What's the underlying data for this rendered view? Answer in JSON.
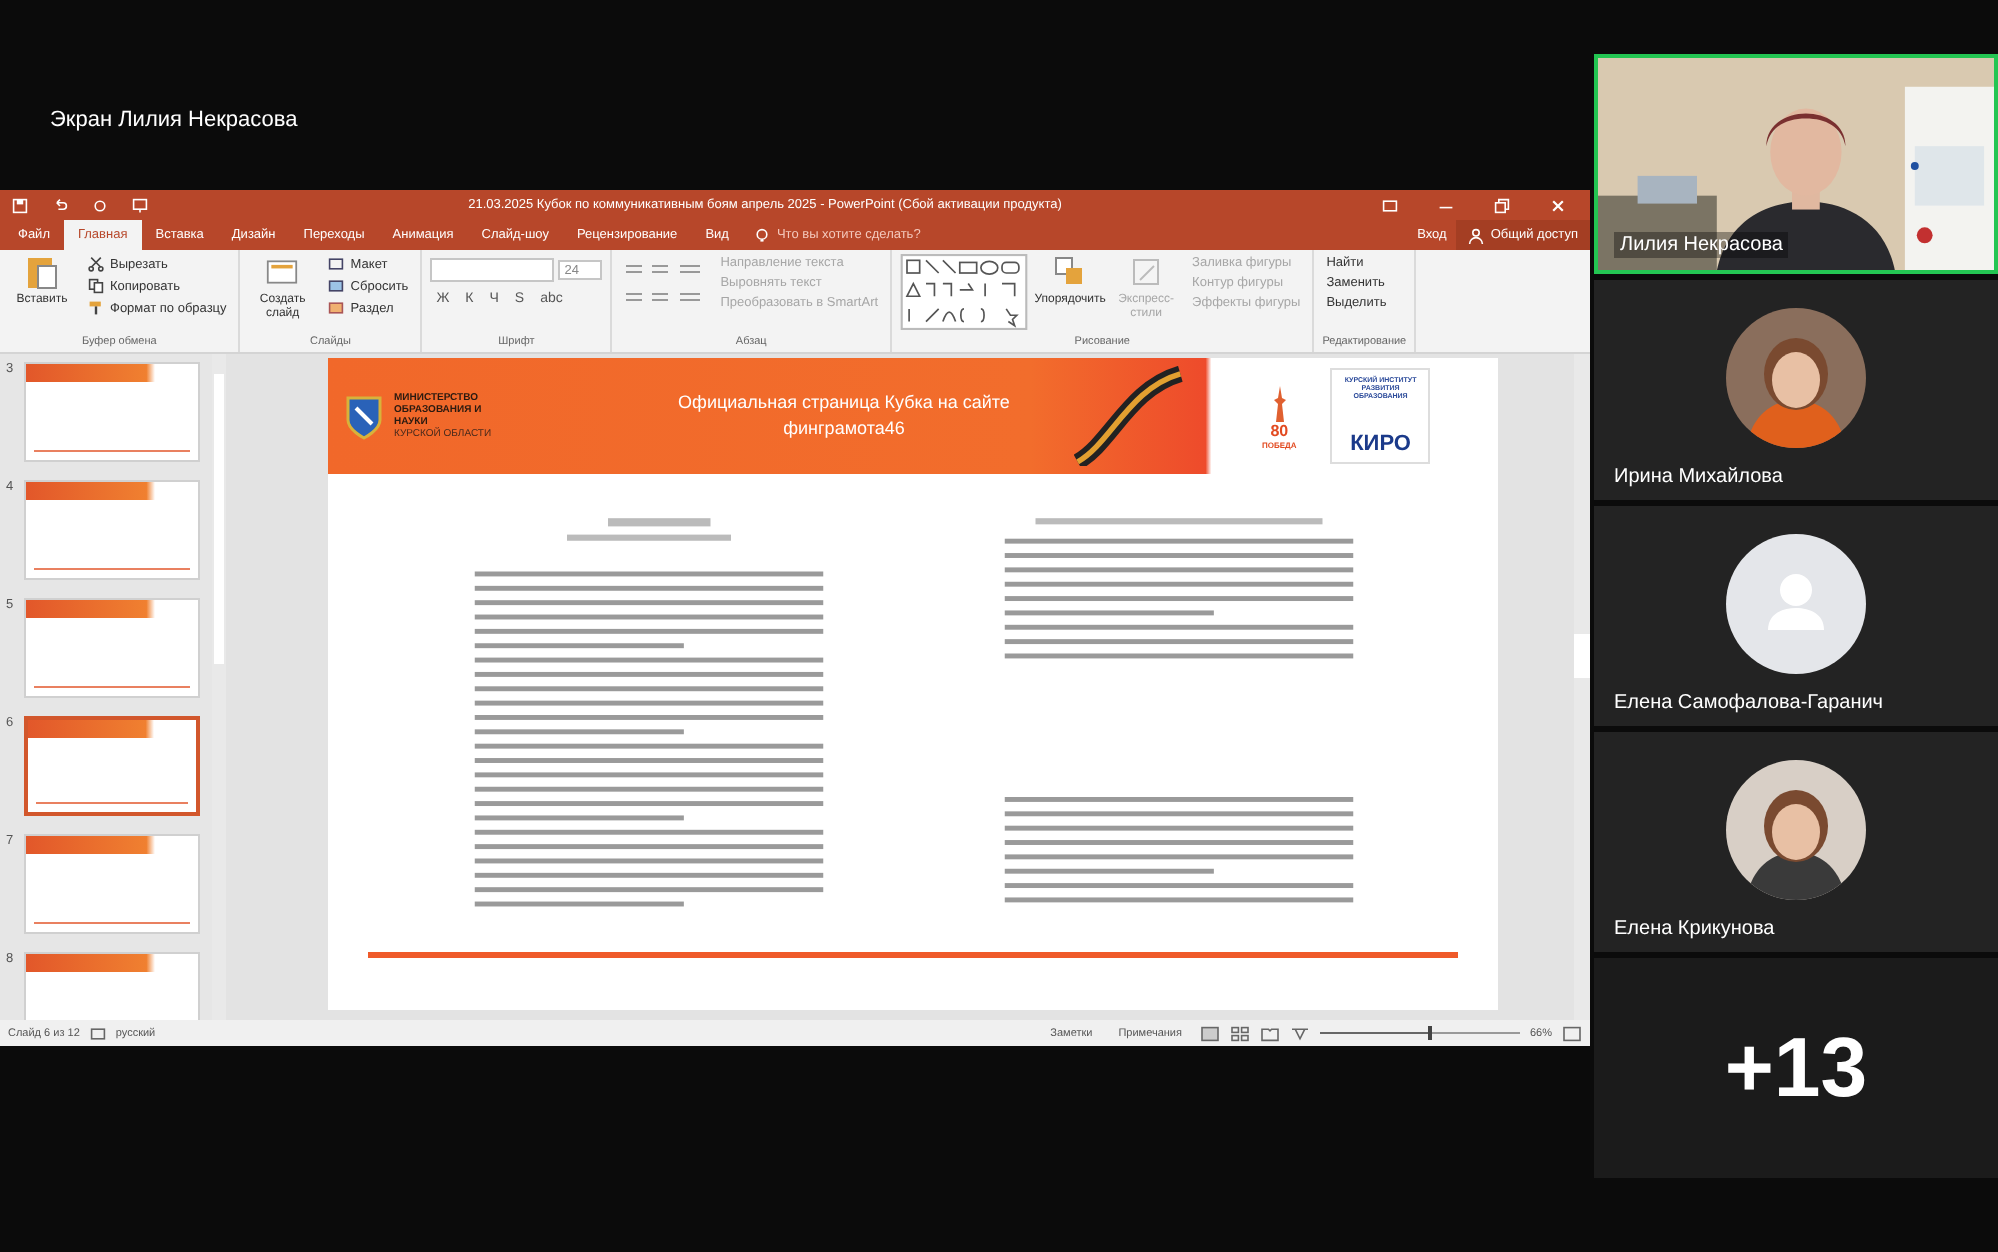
{
  "share_label": "Экран Лилия Некрасова",
  "ppt": {
    "title": "21.03.2025 Кубок по коммуникативным боям апрель 2025 - PowerPoint (Сбой активации продукта)",
    "tabs": [
      {
        "label": "Файл",
        "selected": false
      },
      {
        "label": "Главная",
        "selected": true
      },
      {
        "label": "Вставка",
        "selected": false
      },
      {
        "label": "Дизайн",
        "selected": false
      },
      {
        "label": "Переходы",
        "selected": false
      },
      {
        "label": "Анимация",
        "selected": false
      },
      {
        "label": "Слайд-шоу",
        "selected": false
      },
      {
        "label": "Рецензирование",
        "selected": false
      },
      {
        "label": "Вид",
        "selected": false
      }
    ],
    "tell_me": "Что вы хотите сделать?",
    "sign_in": "Вход",
    "share": "Общий доступ",
    "clipboard": {
      "paste": "Вставить",
      "cut": "Вырезать",
      "copy": "Копировать",
      "format_painter": "Формат по образцу",
      "label": "Буфер обмена"
    },
    "slides": {
      "new_slide": "Создать слайд",
      "layout": "Макет",
      "reset": "Сбросить",
      "section": "Раздел",
      "label": "Слайды"
    },
    "font": {
      "size": "24",
      "buttons": [
        "Ж",
        "К",
        "Ч",
        "S",
        "abc"
      ],
      "label": "Шрифт"
    },
    "paragraph": {
      "items": [
        {
          "label": "Направление текста",
          "disabled": true
        },
        {
          "label": "Выровнять текст",
          "disabled": true
        },
        {
          "label": "Преобразовать в SmartArt",
          "disabled": true
        }
      ],
      "label": "Абзац"
    },
    "drawing": {
      "arrange": "Упорядочить",
      "quick_styles": "Экспресс-стили",
      "items": [
        {
          "label": "Заливка фигуры",
          "disabled": true
        },
        {
          "label": "Контур фигуры",
          "disabled": true
        },
        {
          "label": "Эффекты фигуры",
          "disabled": true
        }
      ],
      "label": "Рисование"
    },
    "editing": {
      "items": [
        "Найти",
        "Заменить",
        "Выделить"
      ],
      "label": "Редактирование"
    },
    "thumbnails": [
      {
        "number": "3",
        "selected": false
      },
      {
        "number": "4",
        "selected": false
      },
      {
        "number": "5",
        "selected": false
      },
      {
        "number": "6",
        "selected": true
      },
      {
        "number": "7",
        "selected": false
      },
      {
        "number": "8",
        "selected": false
      }
    ],
    "slide": {
      "ministry_bold": "МИНИСТЕРСТВО ОБРАЗОВАНИЯ И НАУКИ",
      "ministry_region": "КУРСКОЙ ОБЛАСТИ",
      "header_title": "Официальная страница Кубка на сайте финграмота46",
      "victory_number": "80",
      "victory_word": "ПОБЕДА",
      "kiro_caption": "КУРСКИЙ ИНСТИТУТ РАЗВИТИЯ ОБРАЗОВАНИЯ",
      "kiro_name": "КИРО"
    },
    "status": {
      "slide_counter": "Слайд 6 из 12",
      "language": "русский",
      "notes": "Заметки",
      "comments": "Примечания",
      "zoom": "66%",
      "level": 0.55
    }
  },
  "participants": [
    {
      "name": "Лилия Некрасова",
      "kind": "video",
      "speaking": true
    },
    {
      "name": "Ирина Михайлова",
      "speaking": false
    },
    {
      "name": "Елена Самофалова-Гаранич",
      "kind": "default",
      "speaking": false
    },
    {
      "name": "Елена Крикунова",
      "speaking": false
    }
  ],
  "more_count": "+13"
}
